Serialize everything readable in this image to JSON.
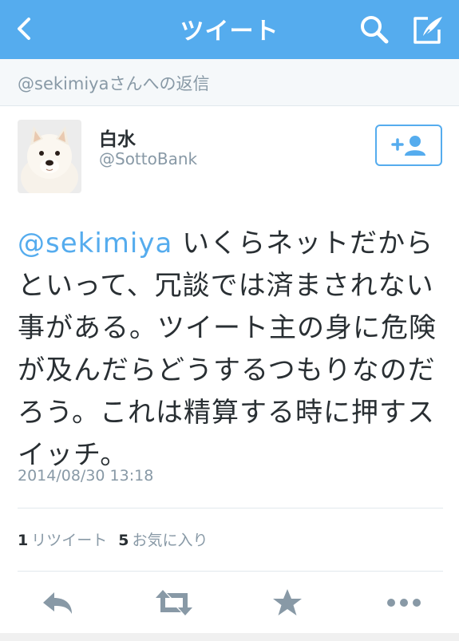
{
  "nav": {
    "title": "ツイート",
    "back_icon": "chevron-left-icon",
    "search_icon": "search-icon",
    "compose_icon": "compose-icon"
  },
  "reply_context": "@sekimiyaさんへの返信",
  "author": {
    "display_name": "白水",
    "screen_name": "@SottoBank"
  },
  "follow_button": {
    "icon": "add-user-icon"
  },
  "tweet": {
    "mention": "@sekimiya",
    "body": " いくらネットだからといって、冗談では済まされない事がある。ツイート主の身に危険が及んだらどうするつもりなのだろう。これは精算する時に押すスイッチ。",
    "timestamp": "2014/08/30 13:18"
  },
  "stats": {
    "retweets_count": "1",
    "retweets_label": "リツイート",
    "favorites_count": "5",
    "favorites_label": "お気に入り"
  },
  "actions": [
    "reply-icon",
    "retweet-icon",
    "favorite-icon",
    "more-icon"
  ],
  "colors": {
    "accent": "#55acee",
    "text": "#292f33",
    "muted": "#8899a6",
    "icon": "#8899a6"
  }
}
